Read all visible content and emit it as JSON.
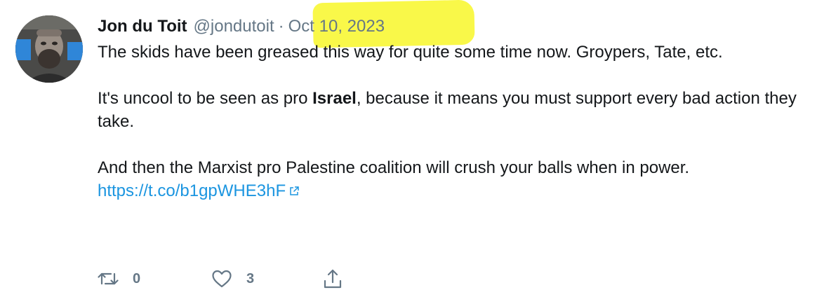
{
  "tweet": {
    "author_name": "Jon du Toit",
    "handle": "@jondutoit",
    "separator": "·",
    "date": "Oct 10, 2023",
    "line1": "The skids have been greased this way for quite some time now. Groypers, Tate, etc.",
    "line2_before": "It's uncool to be seen as pro ",
    "line2_bold": "Israel",
    "line2_after": ", because it means you must support every bad action they take.",
    "line3": "And then the Marxist pro Palestine coalition will crush your balls when in power.",
    "link": "https://t.co/b1gpWHE3hF"
  },
  "actions": {
    "retweet_count": "0",
    "like_count": "3"
  },
  "colors": {
    "handle": "#657786",
    "link": "#1b95e0",
    "highlight": "#f9f73a"
  },
  "icons": [
    "avatar",
    "external-link-icon",
    "retweet-icon",
    "heart-icon",
    "share-icon"
  ]
}
